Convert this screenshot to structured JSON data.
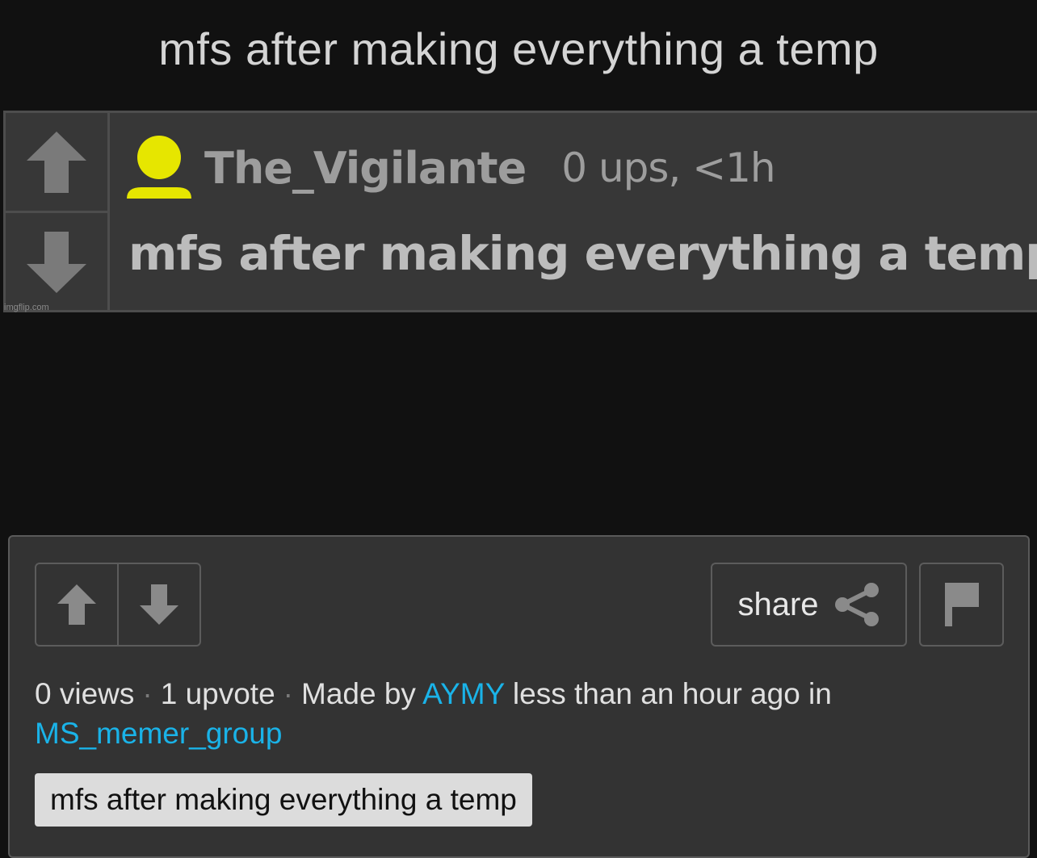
{
  "page": {
    "title": "mfs after making everything a temp"
  },
  "meme": {
    "username": "The_Vigilante",
    "meta": "0 ups, <1h",
    "comment": "mfs after making everything a temp:",
    "watermark": "imgflip.com",
    "avatar_color": "#e6e600"
  },
  "panel": {
    "share_label": "share",
    "views": "0 views",
    "upvotes": "1 upvote",
    "made_by_prefix": "Made by",
    "author": "AYMY",
    "time_text": "less than an hour ago in",
    "group": "MS_memer_group",
    "tag": "mfs after making everything a temp"
  },
  "colors": {
    "background": "#111111",
    "panel": "#333333",
    "link": "#1ab3e8"
  },
  "icons": {
    "upvote": "arrow-up-icon",
    "downvote": "arrow-down-icon",
    "share": "share-icon",
    "flag": "flag-icon",
    "avatar": "user-icon"
  }
}
